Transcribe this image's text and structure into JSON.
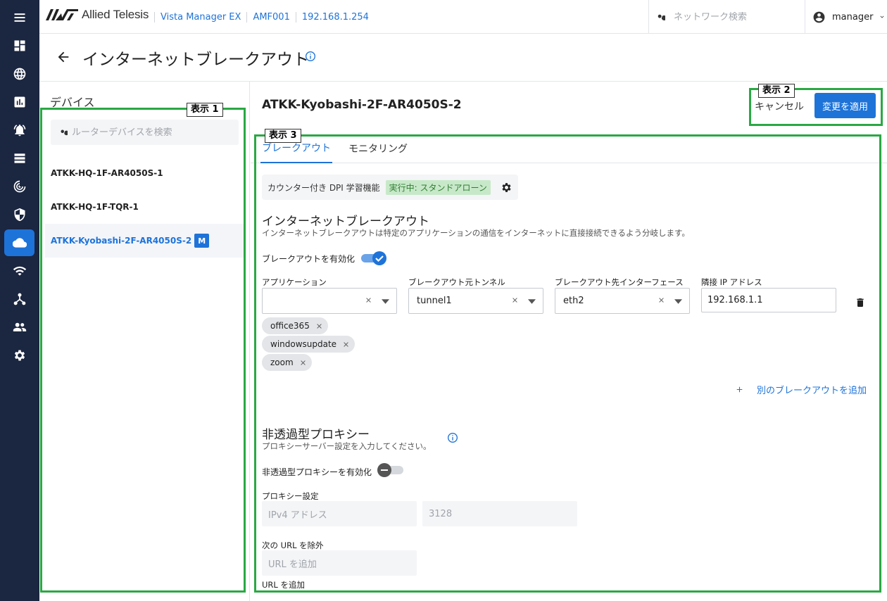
{
  "rail": {
    "items": [
      {
        "name": "menu-icon"
      },
      {
        "name": "dashboard-icon"
      },
      {
        "name": "globe-icon"
      },
      {
        "name": "report-icon"
      },
      {
        "name": "alarm-icon"
      },
      {
        "name": "list-icon"
      },
      {
        "name": "radar-icon"
      },
      {
        "name": "security-shield-icon"
      },
      {
        "name": "cloud-icon",
        "active": true
      },
      {
        "name": "wifi-icon"
      },
      {
        "name": "network-topology-icon"
      },
      {
        "name": "people-icon"
      },
      {
        "name": "settings-gear-icon"
      }
    ]
  },
  "topbar": {
    "brand": "Allied Telesis",
    "breadcrumbs": [
      "Vista Manager EX",
      "AMF001",
      "192.168.1.254"
    ],
    "search_placeholder": "ネットワーク検索",
    "user": "manager"
  },
  "page": {
    "title": "インターネットブレークアウト"
  },
  "devices": {
    "title": "デバイス",
    "search_placeholder": "ルーターデバイスを検索",
    "items": [
      {
        "label": "ATKK-HQ-1F-AR4050S-1"
      },
      {
        "label": "ATKK-HQ-1F-TQR-1"
      },
      {
        "label": "ATKK-Kyobashi-2F-AR4050S-2",
        "badge": "M",
        "selected": true
      }
    ]
  },
  "detail": {
    "device_name": "ATKK-Kyobashi-2F-AR4050S-2",
    "cancel_label": "キャンセル",
    "apply_label": "変更を適用",
    "tabs": [
      "ブレークアウト",
      "モニタリング"
    ],
    "dpi": {
      "label": "カウンター付き DPI 学習機能",
      "status": "実行中: スタンドアローン"
    },
    "breakout": {
      "title": "インターネットブレークアウト",
      "desc": "インターネットブレークアウトは特定のアプリケーションの通信をインターネットに直接接続できるよう分岐します。",
      "enable_label": "ブレークアウトを有効化",
      "enabled": true,
      "labels": {
        "application": "アプリケーション",
        "source_tunnel": "ブレークアウト元トンネル",
        "dest_interface": "ブレークアウト先インターフェース",
        "neighbor_ip": "隣接 IP アドレス"
      },
      "values": {
        "application": "",
        "source_tunnel": "tunnel1",
        "dest_interface": "eth2",
        "neighbor_ip": "192.168.1.1"
      },
      "chips": [
        "office365",
        "windowsupdate",
        "zoom"
      ],
      "add_label": "別のブレークアウトを追加"
    },
    "proxy": {
      "title": "非透過型プロキシー",
      "desc": "プロキシーサーバー設定を入力してください。",
      "enable_label": "非透過型プロキシーを有効化",
      "enabled": false,
      "settings_label": "プロキシー設定",
      "ipv4_placeholder": "IPv4 アドレス",
      "port_placeholder": "3128",
      "exclude_label": "次の URL を除外",
      "url_placeholder": "URL を追加",
      "url_helper": "URL を追加"
    }
  },
  "annotations": [
    {
      "label": "表示 1"
    },
    {
      "label": "表示 2"
    },
    {
      "label": "表示 3"
    }
  ],
  "colors": {
    "accent": "#1e73d8",
    "rail": "#1b2640",
    "annotation": "#2aa844",
    "status_bg": "#c8e9c9",
    "status_fg": "#2e7d32"
  }
}
